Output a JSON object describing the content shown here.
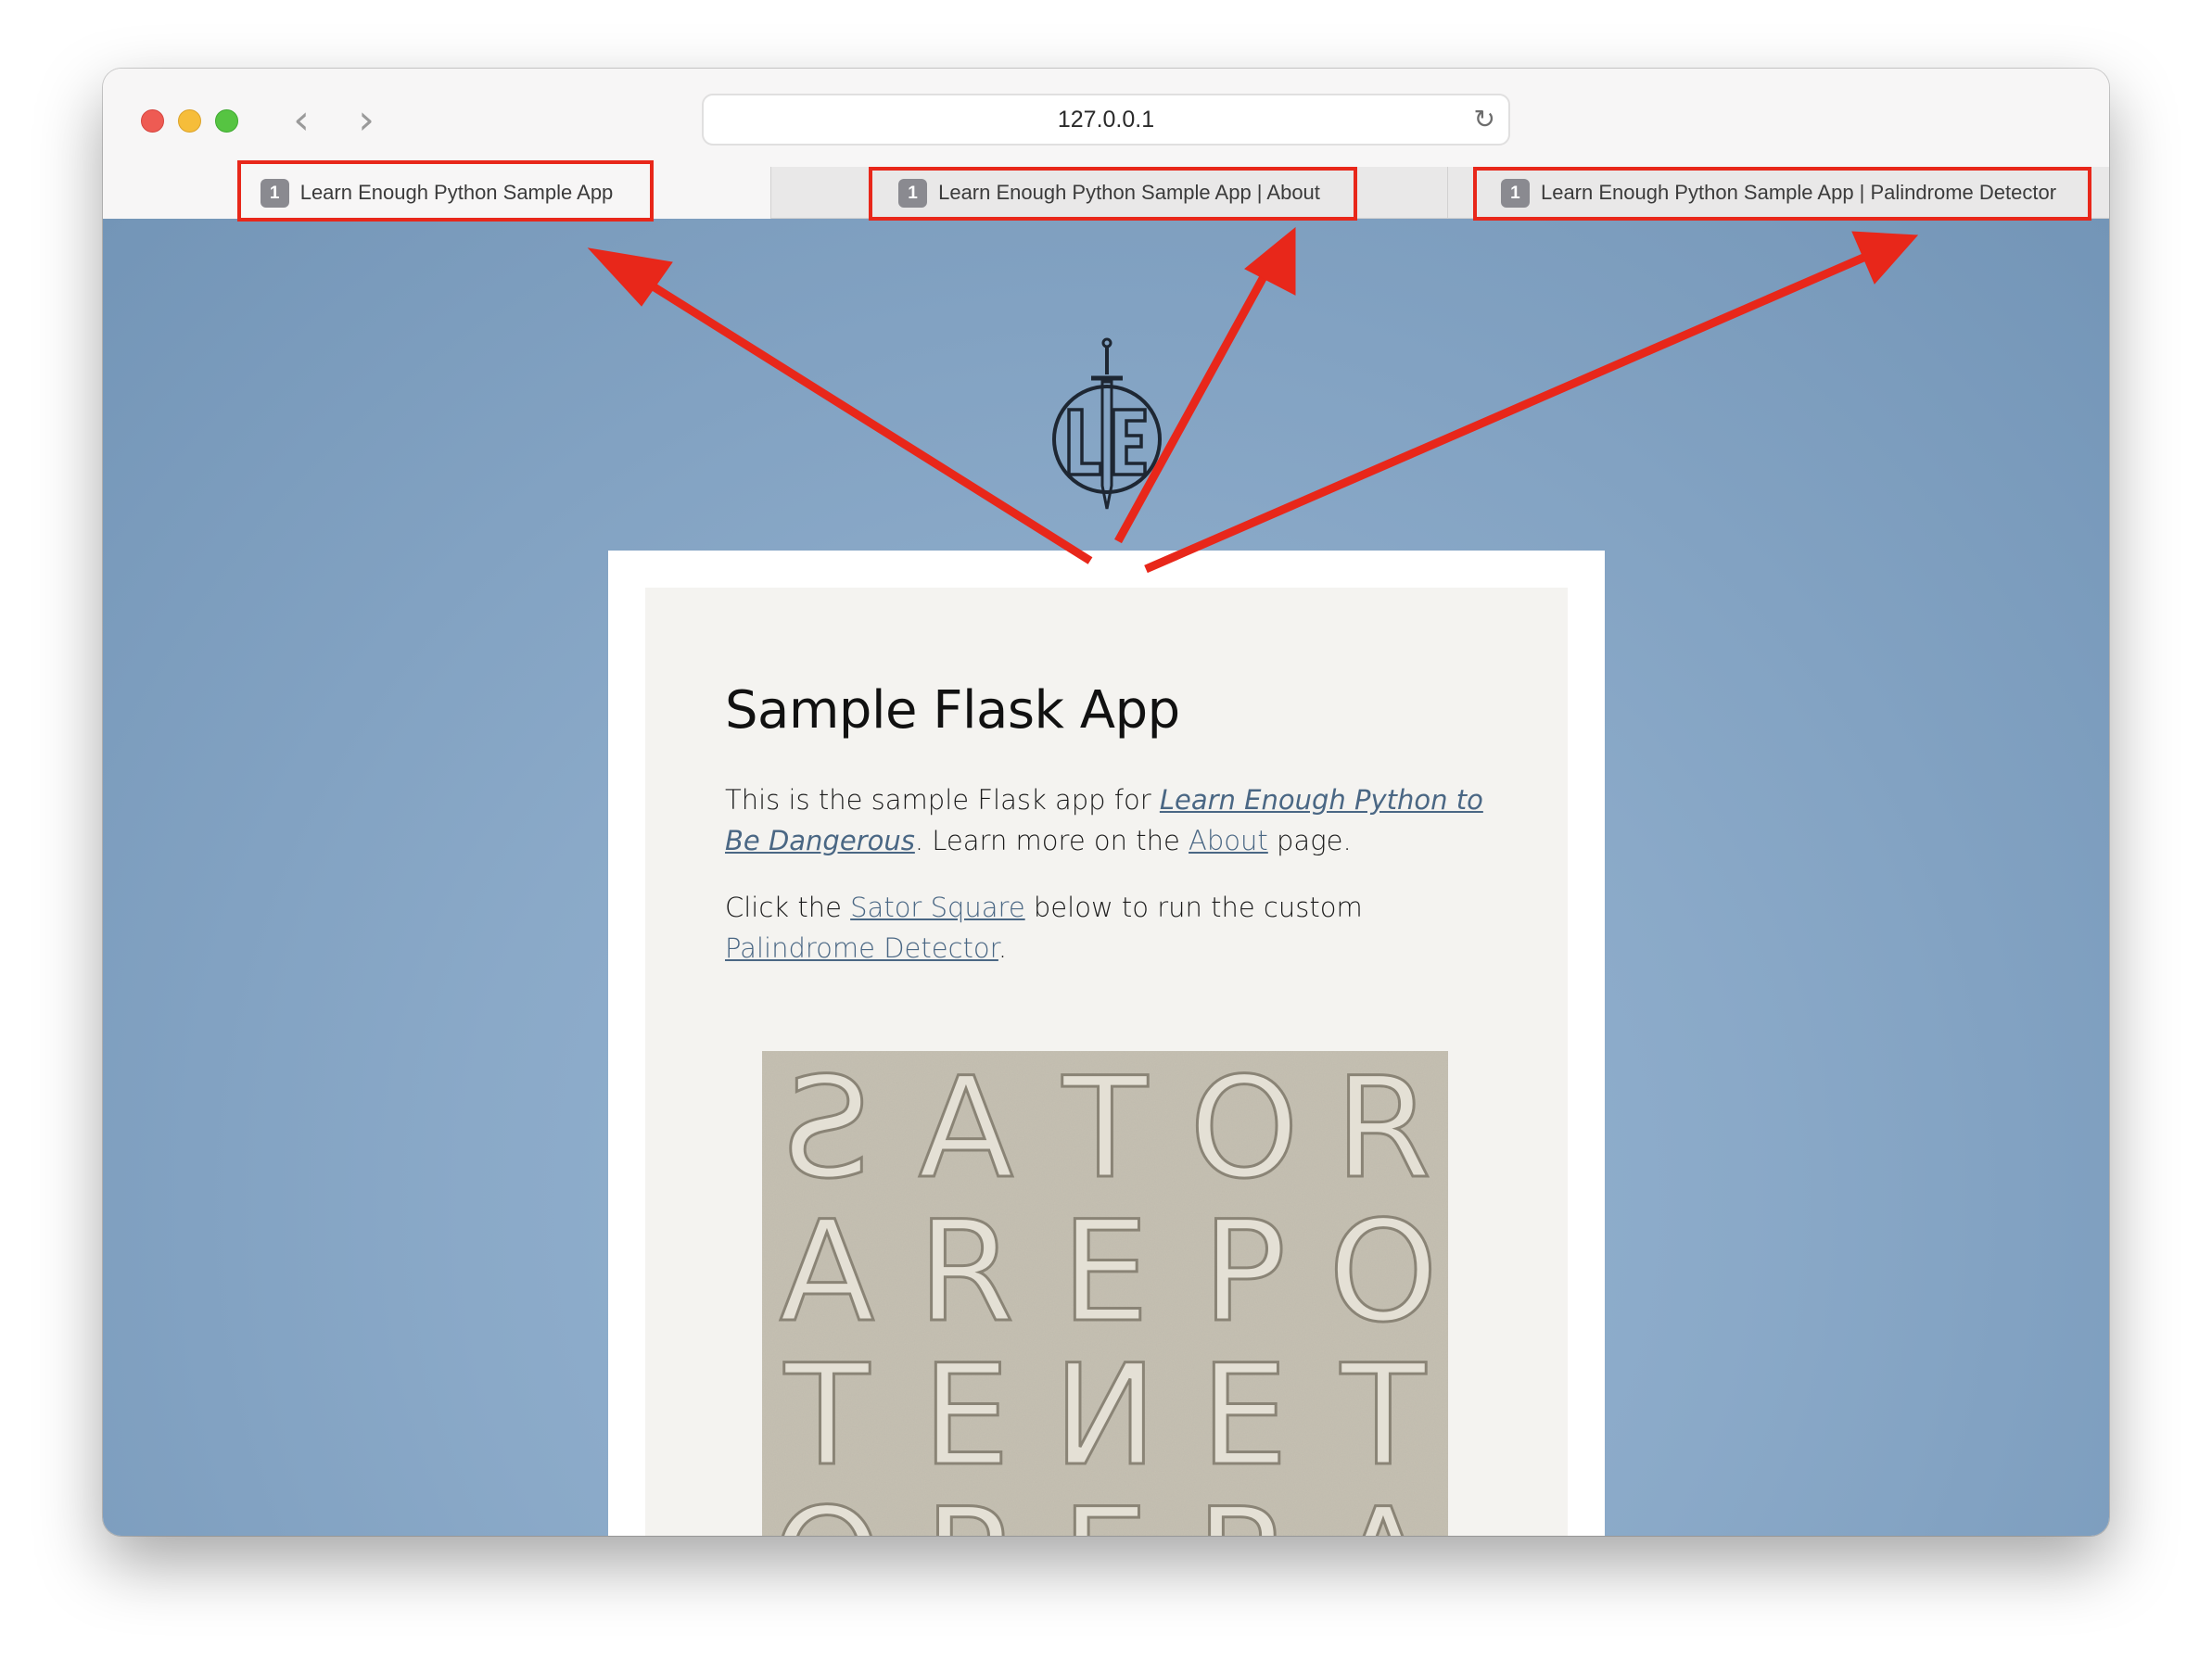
{
  "browser": {
    "address": "127.0.0.1",
    "back_icon": "chevron-left-icon",
    "forward_icon": "chevron-right-icon",
    "reload_icon": "reload-icon",
    "tabs": [
      {
        "badge": "1",
        "label": "Learn Enough Python Sample App",
        "active": true
      },
      {
        "badge": "1",
        "label": "Learn Enough Python Sample App | About",
        "active": false
      },
      {
        "badge": "1",
        "label": "Learn Enough Python Sample App | Palindrome Detector",
        "active": false
      }
    ]
  },
  "page": {
    "title": "Sample Flask App",
    "para1": {
      "prefix": "This is the sample Flask app for ",
      "link_book": "Learn Enough Python to Be Dangerous",
      "mid": ". Learn more on the ",
      "link_about": "About",
      "suffix": " page."
    },
    "para2": {
      "prefix": "Click the ",
      "link_sator": "Sator Square",
      "mid": " below to run the custom ",
      "link_detector": "Palindrome Detector",
      "suffix": "."
    },
    "sator_rows": [
      "SATOR",
      "AREPO",
      "TENET",
      "OPERA"
    ]
  },
  "colors": {
    "annotation": "#e8271a",
    "link": "#4a6784",
    "background": "#8aa9c8"
  }
}
